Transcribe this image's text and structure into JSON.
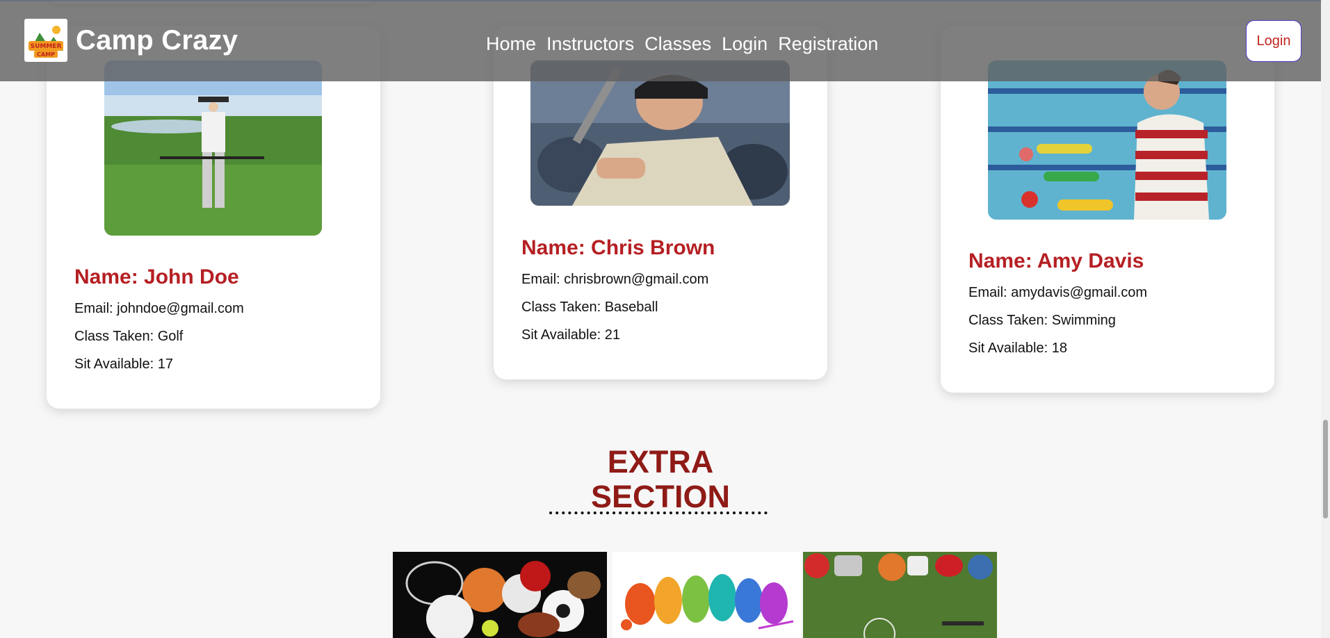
{
  "navbar": {
    "brand": "Camp Crazy",
    "logo_text_top": "SUMMER",
    "logo_text_bottom": "CAMP",
    "links": [
      "Home",
      "Instructors",
      "Classes",
      "Login",
      "Registration"
    ],
    "login_button": "Login"
  },
  "instructors": [
    {
      "name": "Name: John Doe",
      "email": "Email: johndoe@gmail.com",
      "class": "Class Taken: Golf",
      "seats": "Sit Available: 17"
    },
    {
      "name": "Name: Chris Brown",
      "email": "Email: chrisbrown@gmail.com",
      "class": "Class Taken: Baseball",
      "seats": "Sit Available: 21"
    },
    {
      "name": "Name: Amy Davis",
      "email": "Email: amydavis@gmail.com",
      "class": "Class Taken: Swimming",
      "seats": "Sit Available: 18"
    }
  ],
  "extra": {
    "title_line1": "EXTRA",
    "title_line2": "SECTION"
  },
  "colors": {
    "accent_red": "#b51f23",
    "title_red": "#8f1b17",
    "navbar_overlay": "#5f5f5f"
  }
}
